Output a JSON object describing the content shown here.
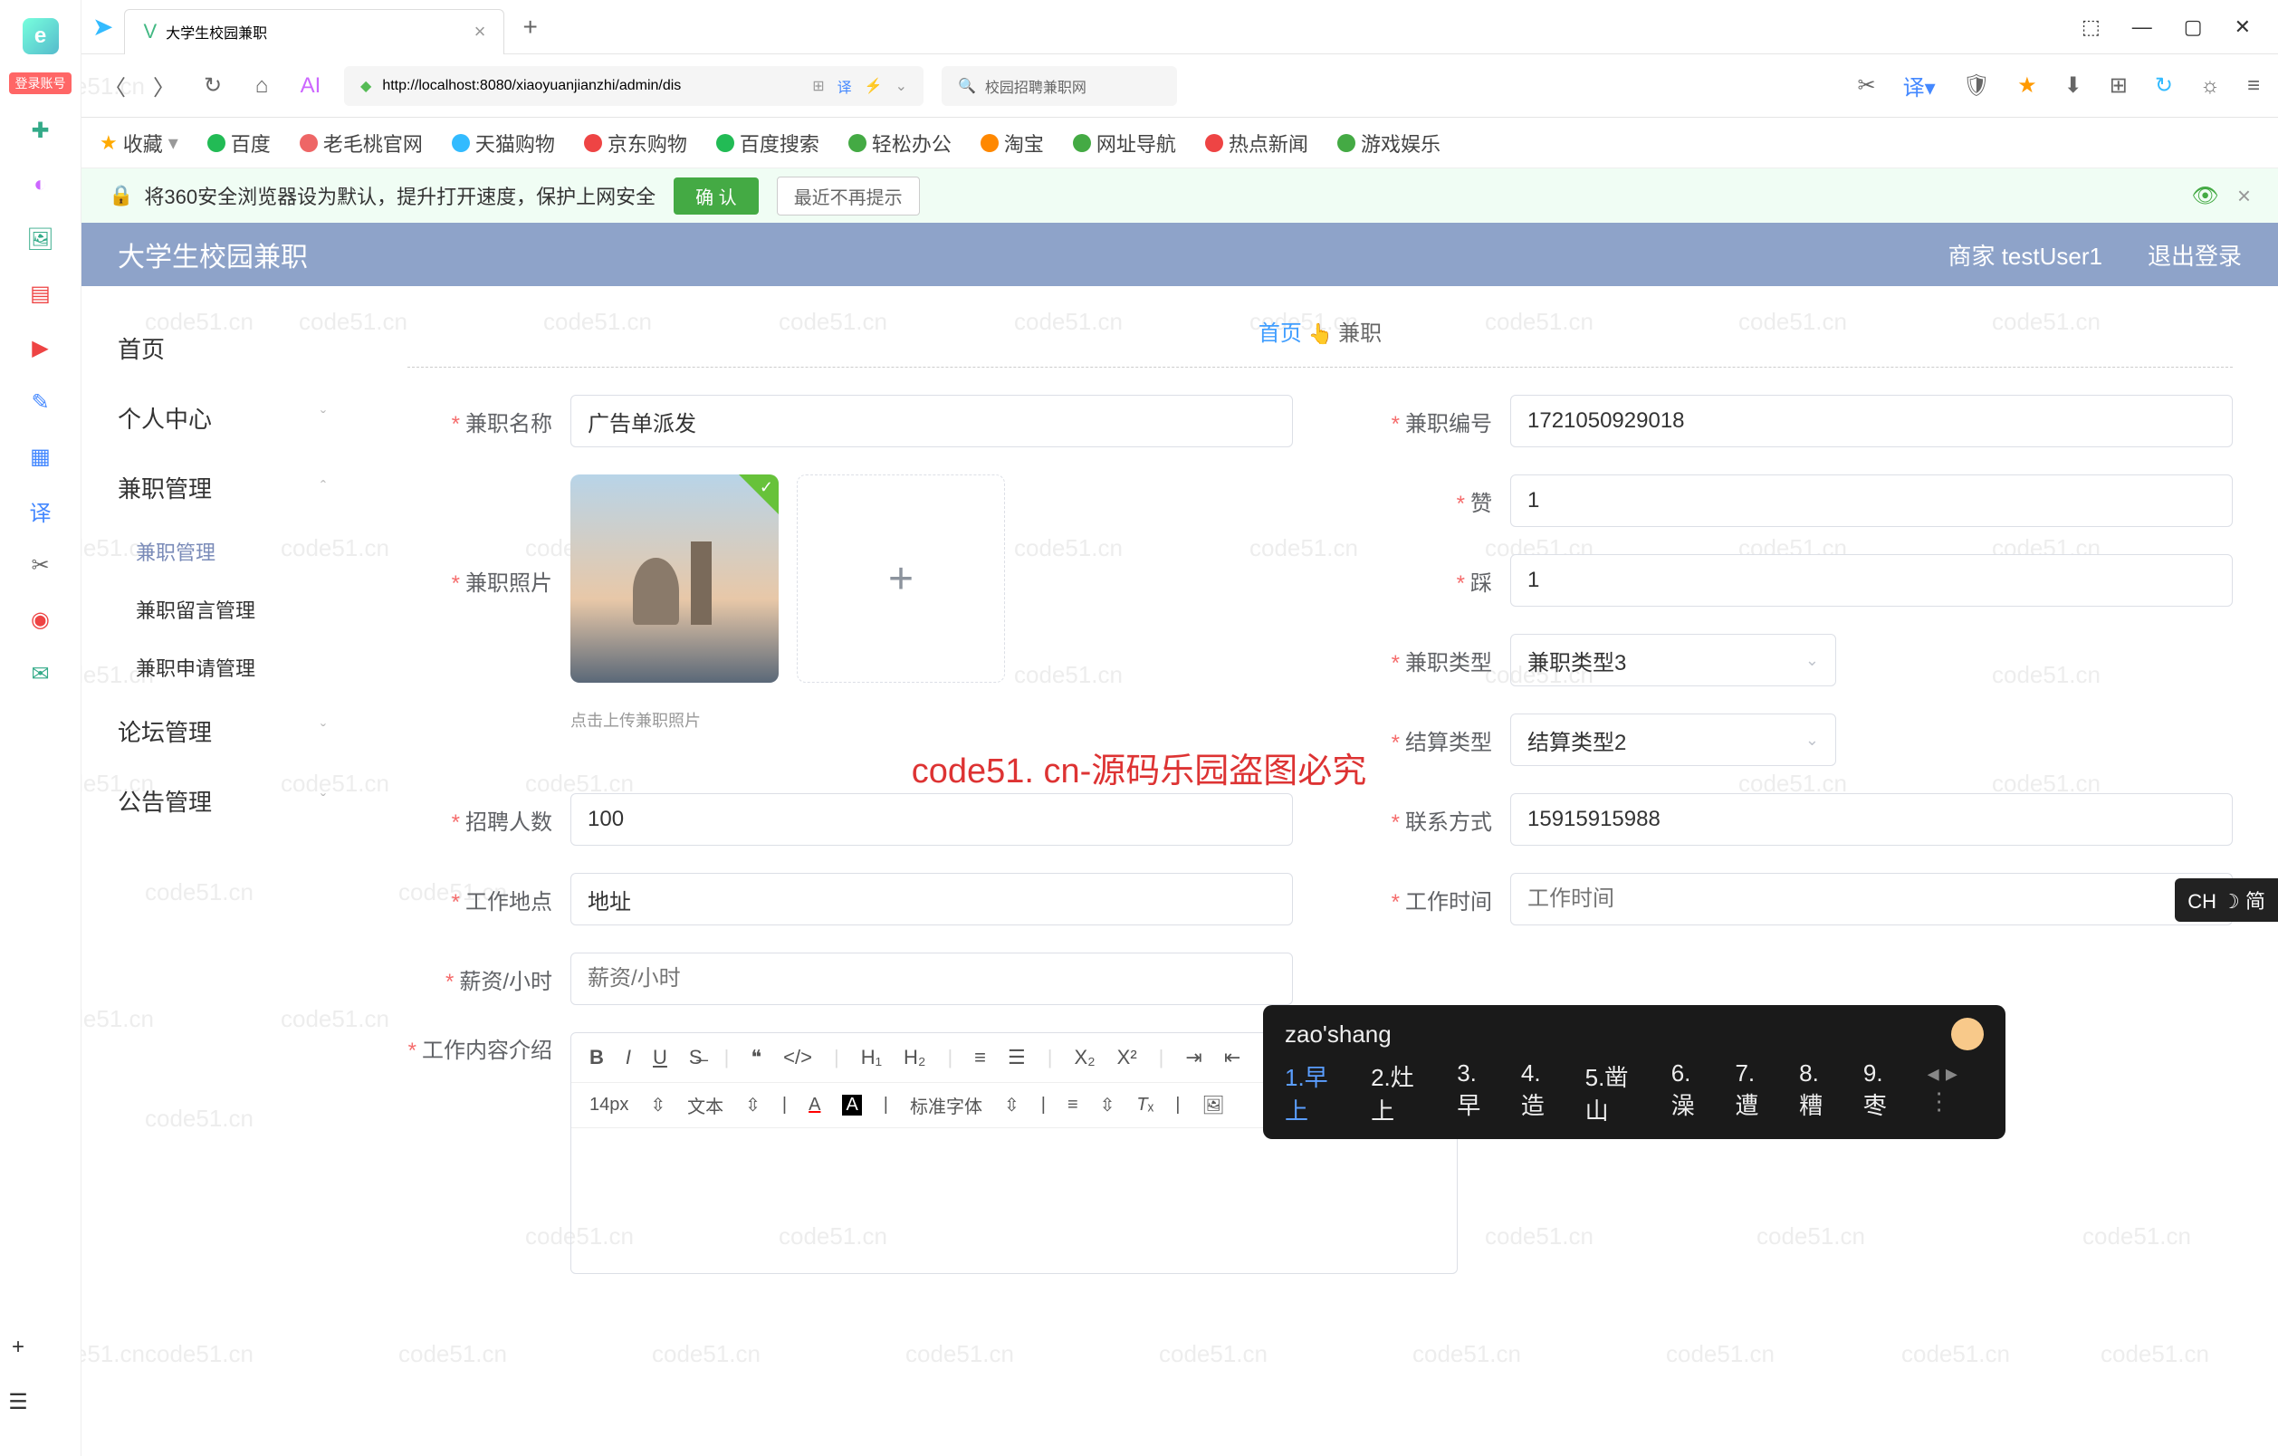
{
  "browser": {
    "tab_title": "大学生校园兼职",
    "url": "http://localhost:8080/xiaoyuanjianzhi/admin/dis",
    "search_placeholder": "校园招聘兼职网",
    "win_controls": [
      "⬚",
      "—",
      "▢",
      "✕"
    ]
  },
  "bookmarks": {
    "fav": "收藏",
    "items": [
      "百度",
      "老毛桃官网",
      "天猫购物",
      "京东购物",
      "百度搜索",
      "轻松办公",
      "淘宝",
      "网址导航",
      "热点新闻",
      "游戏娱乐"
    ]
  },
  "notice": {
    "text": "将360安全浏览器设为默认，提升打开速度，保护上网安全",
    "confirm": "确 认",
    "dismiss": "最近不再提示"
  },
  "header": {
    "title": "大学生校园兼职",
    "user": "商家 testUser1",
    "logout": "退出登录"
  },
  "sidebar": {
    "home": "首页",
    "personal": "个人中心",
    "jobmgmt": "兼职管理",
    "jobmgmt_sub": "兼职管理",
    "msgmgmt": "兼职留言管理",
    "applymgmt": "兼职申请管理",
    "forum": "论坛管理",
    "notice_mgmt": "公告管理"
  },
  "breadcrumb": {
    "home": "首页",
    "current": "兼职"
  },
  "form": {
    "name_label": "兼职名称",
    "name_value": "广告单派发",
    "code_label": "兼职编号",
    "code_value": "1721050929018",
    "photo_label": "兼职照片",
    "photo_hint": "点击上传兼职照片",
    "like_label": "赞",
    "like_value": "1",
    "dislike_label": "踩",
    "dislike_value": "1",
    "jobtype_label": "兼职类型",
    "jobtype_value": "兼职类型3",
    "settle_label": "结算类型",
    "settle_value": "结算类型2",
    "count_label": "招聘人数",
    "count_value": "100",
    "contact_label": "联系方式",
    "contact_value": "15915915988",
    "location_label": "工作地点",
    "location_value": "地址",
    "worktime_label": "工作时间",
    "worktime_placeholder": "工作时间",
    "salary_label": "薪资/小时",
    "salary_placeholder": "薪资/小时",
    "desc_label": "工作内容介绍"
  },
  "editor": {
    "fontsize": "14px",
    "paragraph": "文本",
    "font": "标准字体"
  },
  "ime": {
    "input": "zao'shang",
    "candidates": [
      "1.早上",
      "2.灶上",
      "3.早",
      "4.造",
      "5.凿山",
      "6.澡",
      "7.遭",
      "8.糟",
      "9.枣"
    ]
  },
  "ch_badge": "CH ☽ 简",
  "watermark": "code51.cn",
  "watermark_center": "code51. cn-源码乐园盗图必究",
  "login_badge": "登录账号"
}
